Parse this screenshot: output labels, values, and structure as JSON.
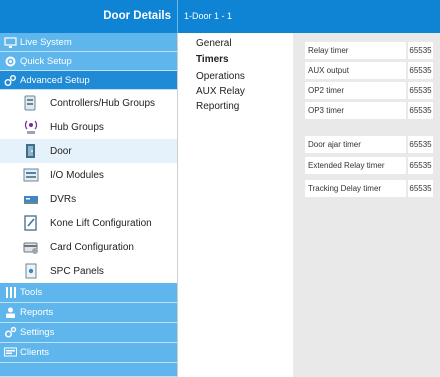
{
  "header": {
    "title": "Door Details",
    "breadcrumb": "1-Door 1 - 1"
  },
  "sidebar": {
    "sections_top": [
      {
        "label": "Live System",
        "icon": "monitor-icon"
      },
      {
        "label": "Quick Setup",
        "icon": "gear-icon"
      },
      {
        "label": "Advanced Setup",
        "icon": "gears-icon"
      }
    ],
    "items": [
      {
        "label": "Controllers/Hub Groups",
        "icon": "controller-icon"
      },
      {
        "label": "Hub Groups",
        "icon": "hub-icon"
      },
      {
        "label": "Door",
        "icon": "door-icon"
      },
      {
        "label": "I/O Modules",
        "icon": "io-module-icon"
      },
      {
        "label": "DVRs",
        "icon": "dvr-icon"
      },
      {
        "label": "Kone Lift Configuration",
        "icon": "lift-icon"
      },
      {
        "label": "Card Configuration",
        "icon": "card-icon"
      },
      {
        "label": "SPC Panels",
        "icon": "spc-panel-icon"
      }
    ],
    "sections_bottom": [
      {
        "label": "Tools",
        "icon": "tools-icon"
      },
      {
        "label": "Reports",
        "icon": "reports-icon"
      },
      {
        "label": "Settings",
        "icon": "settings-icon"
      },
      {
        "label": "Clients",
        "icon": "clients-icon"
      }
    ]
  },
  "tabs": [
    {
      "label": "General"
    },
    {
      "label": "Timers"
    },
    {
      "label": "Operations"
    },
    {
      "label": "AUX Relay"
    },
    {
      "label": "Reporting"
    }
  ],
  "timers": {
    "group1": [
      {
        "label": "Relay timer",
        "value": "65535"
      },
      {
        "label": "AUX output",
        "value": "65535"
      },
      {
        "label": "OP2 timer",
        "value": "65535"
      },
      {
        "label": "OP3 timer",
        "value": "65535"
      }
    ],
    "group2": [
      {
        "label": "Door ajar timer",
        "value": "65535"
      },
      {
        "label": "Extended Relay timer",
        "value": "65535"
      },
      {
        "label": "Tracking Delay timer",
        "value": "65535"
      }
    ]
  },
  "colors": {
    "header": "#0f83d4",
    "section": "#5fb6ec",
    "section_active": "#1f8ad6",
    "selected_row": "#e6f2fb",
    "panel": "#e9e9e9"
  }
}
